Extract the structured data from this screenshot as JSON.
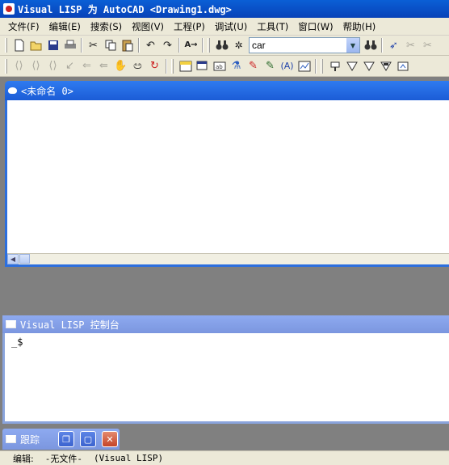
{
  "app": {
    "title": "Visual LISP 为 AutoCAD <Drawing1.dwg>"
  },
  "menu": [
    "文件(F)",
    "编辑(E)",
    "搜索(S)",
    "视图(V)",
    "工程(P)",
    "调试(U)",
    "工具(T)",
    "窗口(W)",
    "帮助(H)"
  ],
  "toolbar": {
    "search_value": "car"
  },
  "editor": {
    "title": "<未命名 0>"
  },
  "console": {
    "title": "Visual LISP 控制台",
    "prompt": "_$"
  },
  "trace": {
    "title": "跟踪"
  },
  "status": {
    "mode": "编辑:",
    "file": "-无文件-",
    "context": "(Visual LISP)"
  },
  "colors": {
    "titlebar": "#0a5fd6",
    "active_window": "#2f7bf0",
    "inactive_window": "#8eaaf0",
    "close_button": "#c4442a"
  }
}
